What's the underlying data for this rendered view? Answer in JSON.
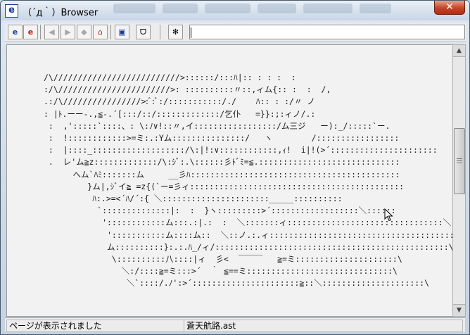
{
  "window": {
    "title": "（´д｀）Browser",
    "app_icon": "e",
    "close_glyph": "✕"
  },
  "toolbar": {
    "buttons": [
      {
        "name": "ie-open-icon",
        "glyph": "e"
      },
      {
        "name": "ie-stop-icon",
        "glyph": "e"
      },
      {
        "name": "back-icon",
        "glyph": "◀"
      },
      {
        "name": "forward-icon",
        "glyph": "▶"
      },
      {
        "name": "reload-icon",
        "glyph": "◆"
      },
      {
        "name": "home-icon",
        "glyph": "⌂"
      },
      {
        "name": "favorites-icon",
        "glyph": "▣"
      },
      {
        "name": "mona-icon",
        "glyph": "ᗜ"
      },
      {
        "name": "settings-icon",
        "glyph": "✻"
      }
    ],
    "address_value": ""
  },
  "content": {
    "ascii_art": "/\\//////////////////////////>::::::/:::ﾊ|:: : : :  :\n:/\\///////////////////////>: ::::::::::〃::,ィム{:: :  :  /,\n.:/\\////////////////>:ﾞ:ﾞ:/:::::::::::/./    ﾊ:: : :/〃 ノ\n: |ﾄ.ーー-.,≦-.´[:::/::/:::::::::::::/乞仆   =}}:;:ィノ/.: \n :  ,':::::`::::、: \\:ﾉ∨!::〃,イ:::::::::::::::::/ム三ジ   ー):_/:::::`ー.\n :  !::::::::::::>=ミ:.:Yム:::::::::::::::/   ヽ        /:::::::::::::::::\n :  |::::_:::::::::::::::::::/\\:|!:∨::::::::::::,ｨ!  i|!(>´::::::::::::::::::::::\n .  レ'ム≧z:::::::::::::/\\:ｼﾞ:.\\::::::彡ﾄﾞﾐ=≦.:::::::::::::::::::::::::::::\n      へム`ﾊﾐ:::::::ム     __彡ﾊ:::::::::::::::::::::::::::::::::::::::::::\n         }ム|,ｼﾞイ≧ =z{(`ー=彡ィ::::::::::::::::::::::::::::::::::::::::::::\n          ﾊ:.>=<´ﾊ/´:{ ＼::::::::::::::::::::::_____::::::::::\n           `::::::::::::::|:  :  }ヽ:::::::::>´::::::::::::::::::＼::::::\n            '::::::::::::ム:::.:|.:  :  ＼:::::::ィ::::::::::::::::::::::::::::::::＼:\n             ':::::::::::ム::::ム::  ＼::ノ.:.ィ:::::::::::::::::::::::::::::::::::::::\\\n             ム::::::::::}:.:.ﾊ_/ィ/::::::::::::::::::::::::::::::::::::::::::::::::\\\n              \\::::::::::八::::|ィ  彡<  ￣￣￣   ≧=ミ:::::::::::::::::::::\\\n                ＼:/::::≧=ミ:::>´  ｀ ≦==ミ::::::::::::::::::::::::::::::\\\n                 ＼`::::/.ﾉ':>´::::::::::::::::::::::≧::＼:::::::::::::::::::::\\"
  },
  "status": {
    "message": "ページが表示されました",
    "file": "蒼天航路.ast"
  }
}
